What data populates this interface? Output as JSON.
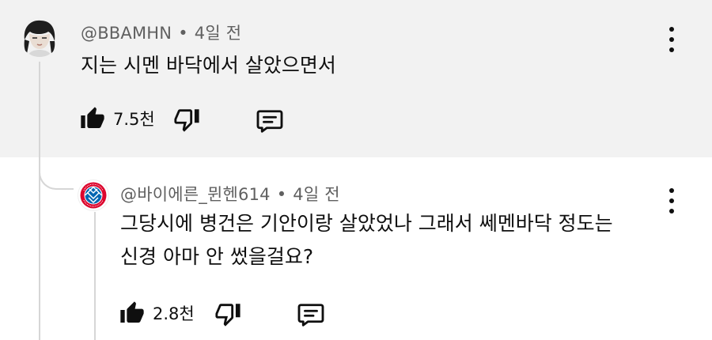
{
  "comments": [
    {
      "author": "@BBAMHN",
      "separator": "•",
      "time": "4일 전",
      "text": "지는 시멘 바닥에서 살았으면서",
      "likes": "7.5천",
      "avatar": "user-photo-avatar"
    },
    {
      "author": "@바이에른_뮌헨614",
      "separator": "•",
      "time": "4일 전",
      "text_line1": "그당시에 병건은 기안이랑 살았었나 그래서 쎄멘바닥 정도는",
      "text_line2": "신경 아마 안 썼을걸요?",
      "likes": "2.8천",
      "avatar": "fc-bayern-logo-avatar",
      "badge_color": "#dc052d",
      "badge_blue": "#0066b2"
    }
  ],
  "icons": {
    "like": "thumbs-up-icon",
    "dislike": "thumbs-down-icon",
    "reply": "reply-comment-icon",
    "menu": "more-vert-icon"
  },
  "colors": {
    "highlight_background": "#f2f2f2",
    "secondary_text": "#606060",
    "thread_line": "#d6d6d6"
  }
}
